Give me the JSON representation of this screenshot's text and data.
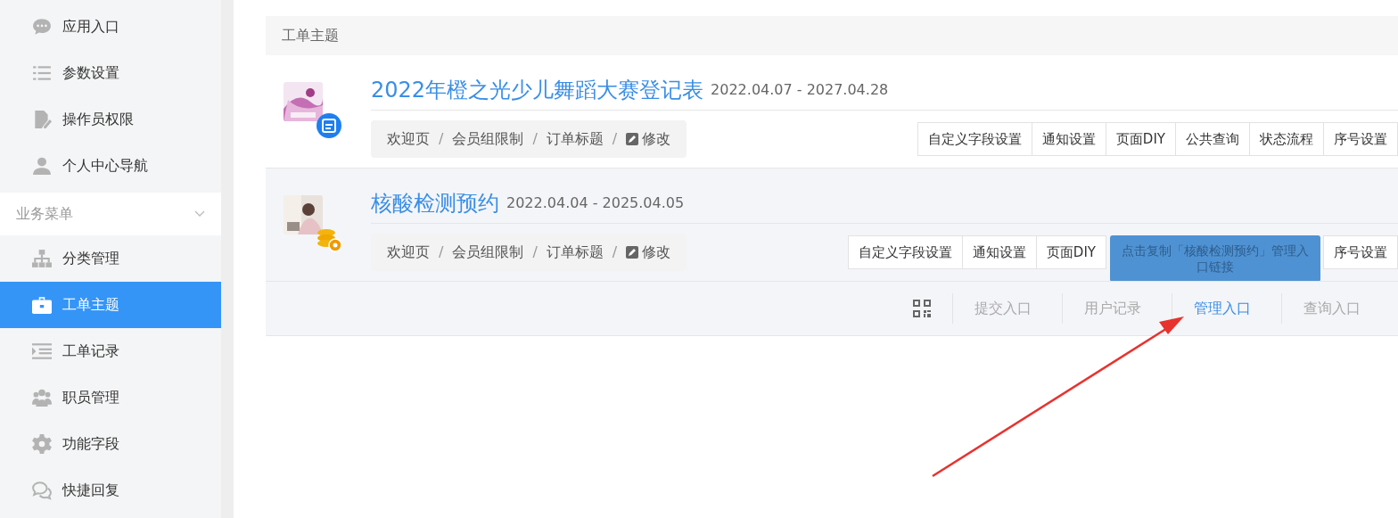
{
  "sidebar": {
    "items": [
      {
        "label": "应用入口",
        "selected": false
      },
      {
        "label": "参数设置",
        "selected": false
      },
      {
        "label": "操作员权限",
        "selected": false
      },
      {
        "label": "个人中心导航",
        "selected": false
      }
    ],
    "section": {
      "label": "业务菜单",
      "expanded": true,
      "items": [
        {
          "label": "分类管理",
          "selected": false
        },
        {
          "label": "工单主题",
          "selected": true
        },
        {
          "label": "工单记录",
          "selected": false
        },
        {
          "label": "职员管理",
          "selected": false
        },
        {
          "label": "功能字段",
          "selected": false
        },
        {
          "label": "快捷回复",
          "selected": false
        }
      ]
    }
  },
  "panel": {
    "title": "工单主题",
    "topics": [
      {
        "title": "2022年橙之光少儿舞蹈大赛登记表",
        "dates": "2022.04.07 - 2027.04.28",
        "separator": "/",
        "breadcrumb": [
          "欢迎页",
          "会员组限制",
          "订单标题",
          "修改"
        ],
        "buttons": [
          {
            "kind": "button",
            "label": "自定义字段设置"
          },
          {
            "kind": "button",
            "label": "通知设置"
          },
          {
            "kind": "button",
            "label": "页面DIY"
          },
          {
            "kind": "button",
            "label": "公共查询"
          },
          {
            "kind": "button",
            "label": "状态流程"
          },
          {
            "kind": "button",
            "label": "序号设置"
          }
        ]
      },
      {
        "title": "核酸检测预约",
        "dates": "2022.04.04 - 2025.04.05",
        "separator": "/",
        "breadcrumb": [
          "欢迎页",
          "会员组限制",
          "订单标题",
          "修改"
        ],
        "buttons": [
          {
            "kind": "button",
            "label": "自定义字段设置"
          },
          {
            "kind": "button",
            "label": "通知设置"
          },
          {
            "kind": "button",
            "label": "页面DIY"
          },
          {
            "kind": "covered"
          },
          {
            "kind": "button",
            "label": "序号设置"
          }
        ]
      }
    ],
    "toolbar": [
      {
        "label": "提交入口",
        "selected": false
      },
      {
        "label": "用户记录",
        "selected": false
      },
      {
        "label": "管理入口",
        "selected": true
      },
      {
        "label": "查询入口",
        "selected": false
      }
    ],
    "tooltip": "点击复制「核酸检测预约」管理入口链接"
  }
}
